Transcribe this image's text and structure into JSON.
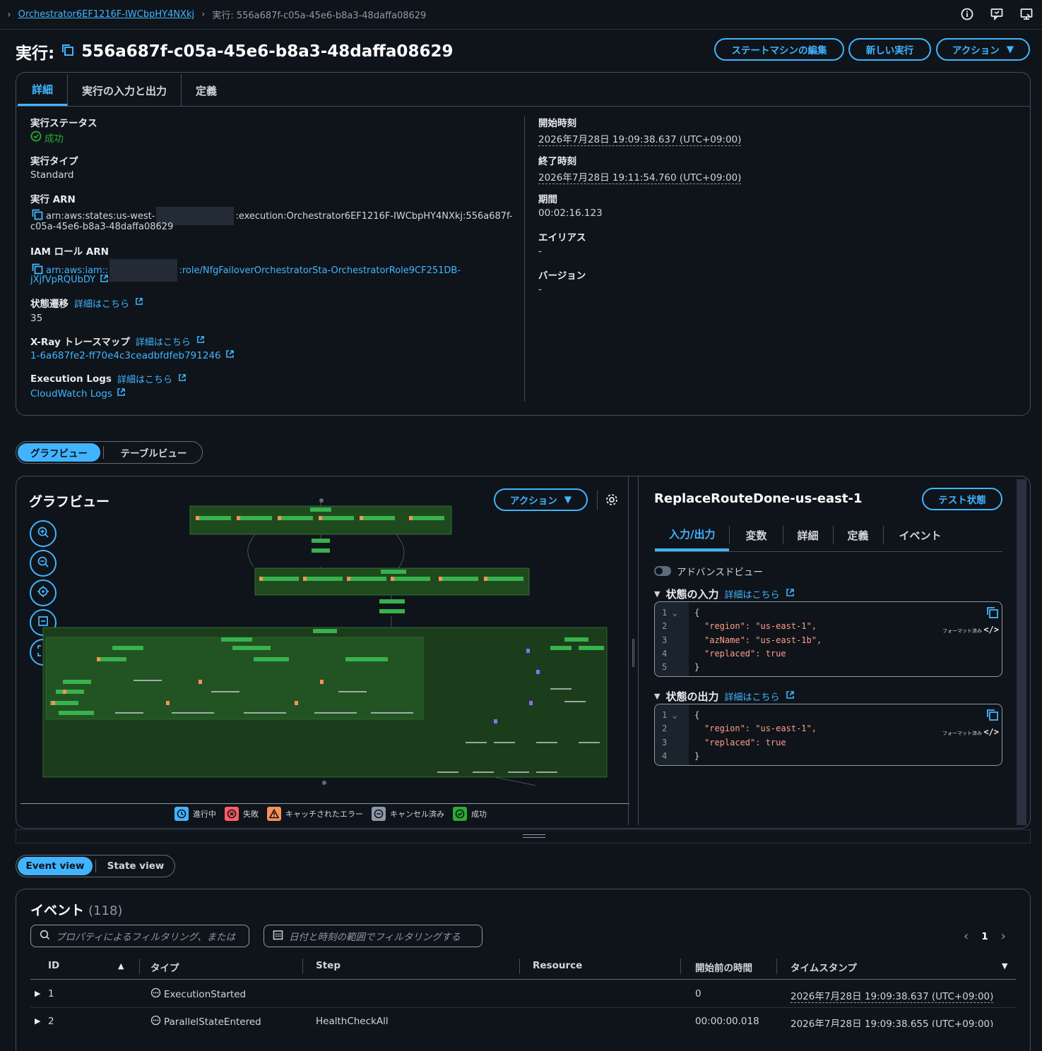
{
  "breadcrumb": {
    "parent": "Orchestrator6EF1216F-IWCbpHY4NXkj",
    "current": "実行: 556a687f-c05a-45e6-b8a3-48daffa08629"
  },
  "header": {
    "title_prefix": "実行:",
    "title_id": "556a687f-c05a-45e6-b8a3-48daffa08629",
    "edit_button": "ステートマシンの編集",
    "new_exec_button": "新しい実行",
    "actions_button": "アクション"
  },
  "details_tabs": [
    "詳細",
    "実行の入力と出力",
    "定義"
  ],
  "details": {
    "status_label": "実行ステータス",
    "status_value": "成功",
    "type_label": "実行タイプ",
    "type_value": "Standard",
    "arn_label": "実行 ARN",
    "arn_part1": "arn:aws:states:us-west-",
    "arn_part2": ":execution:Orchestrator6EF1216F-IWCbpHY4NXkj:556a687f-",
    "arn_line2": "c05a-45e6-b8a3-48daffa08629",
    "iam_label": "IAM ロール ARN",
    "iam_part1": "arn:aws:iam::",
    "iam_part2": ":role/NfgFailoverOrchestratorSta-OrchestratorRole9CF251DB-",
    "iam_line2": "jXjfVpRQUbDY",
    "transitions_label": "状態遷移",
    "transitions_link": "詳細はこちら",
    "transitions_value": "35",
    "xray_label": "X-Ray トレースマップ",
    "xray_link": "詳細はこちら",
    "xray_value": "1-6a687fe2-ff70e4c3ceadbfdfeb791246",
    "logs_label": "Execution Logs",
    "logs_link": "詳細はこちら",
    "logs_value": "CloudWatch Logs",
    "start_label": "開始時刻",
    "start_value": "2026年7月28日 19:09:38.637 (UTC+09:00)",
    "end_label": "終了時刻",
    "end_value": "2026年7月28日 19:11:54.760 (UTC+09:00)",
    "duration_label": "期間",
    "duration_value": "00:02:16.123",
    "alias_label": "エイリアス",
    "alias_value": "-",
    "version_label": "バージョン",
    "version_value": "-"
  },
  "view_toggle": {
    "graph": "グラフビュー",
    "table": "テーブルビュー"
  },
  "graph": {
    "title": "グラフビュー",
    "actions_button": "アクション",
    "legend": [
      {
        "label": "進行中",
        "color": "#42b4ff",
        "icon": "clock-icon"
      },
      {
        "label": "失敗",
        "color": "#ff5d64",
        "icon": "x-circle-icon"
      },
      {
        "label": "キャッチされたエラー",
        "color": "#f89256",
        "icon": "warning-icon"
      },
      {
        "label": "キャンセル済み",
        "color": "#8d99a8",
        "icon": "minus-circle-icon"
      },
      {
        "label": "成功",
        "color": "#29ad32",
        "icon": "check-circle-icon"
      }
    ]
  },
  "state_panel": {
    "title": "ReplaceRouteDone-us-east-1",
    "test_button": "テスト状態",
    "tabs": [
      "入力/出力",
      "変数",
      "詳細",
      "定義",
      "イベント"
    ],
    "advanced_view": "アドバンスドビュー",
    "input_label": "状態の入力",
    "input_link": "詳細はこちら",
    "output_label": "状態の出力",
    "output_link": "詳細はこちら",
    "formatted": "フォーマット済み",
    "input_lines": [
      "{",
      "\"region\": \"us-east-1\",",
      "\"azName\": \"us-east-1b\",",
      "\"replaced\": true",
      "}"
    ],
    "output_lines": [
      "{",
      "\"region\": \"us-east-1\",",
      "\"replaced\": true",
      "}"
    ]
  },
  "event_toggle": {
    "event": "Event view",
    "state": "State view"
  },
  "events": {
    "title": "イベント",
    "count": "(118)",
    "filter_placeholder": "プロパティによるフィルタリング、または",
    "date_filter": "日付と時刻の範囲でフィルタリングする",
    "page": "1",
    "columns": [
      "ID",
      "タイプ",
      "Step",
      "Resource",
      "開始前の時間",
      "タイムスタンプ"
    ],
    "rows": [
      {
        "id": "1",
        "type": "ExecutionStarted",
        "step": "",
        "resource": "",
        "elapsed": "0",
        "timestamp": "2026年7月28日 19:09:38.637 (UTC+09:00)"
      },
      {
        "id": "2",
        "type": "ParallelStateEntered",
        "step": "HealthCheckAll",
        "resource": "",
        "elapsed": "00:00:00.018",
        "timestamp": "2026年7月28日 19:09:38.655 (UTC+09:00)"
      }
    ]
  }
}
